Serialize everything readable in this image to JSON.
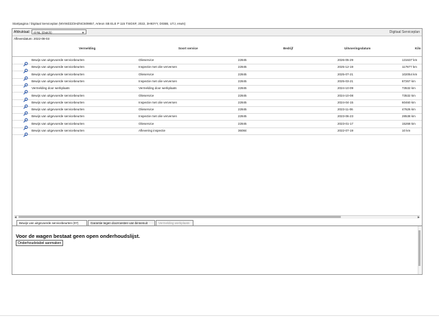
{
  "breadcrumb": "Startpagina / Digitaal Serviceplan (WVWZZZ3HZNC509857, Arteon SB ELE P 115 TSIDSF, 2022, 3H93YY, DGBB, U7J, erwin)",
  "toolbar": {
    "print_label": "Afdruktaal:",
    "language_value": "nl-NL (Dutch)",
    "app_title": "Digitaal Serviceplan"
  },
  "print_date": "Afleverdatum: 2022-08-03",
  "table": {
    "columns": [
      "Vermelding",
      "Soort service",
      "Bedrijf",
      "Uitvoeringsdatum",
      "Kilo"
    ],
    "rows": [
      {
        "entry": "Bewijs van uitgevoerde servicebeurten",
        "type": "Olieservice",
        "company": "22845",
        "date": "2026-05-29",
        "km": "131637 km"
      },
      {
        "entry": "Bewijs van uitgevoerde servicebeurten",
        "type": "Inspectie met olie verversen",
        "company": "22845",
        "date": "2025-12-19",
        "km": "117877 km"
      },
      {
        "entry": "Bewijs van uitgevoerde servicebeurten",
        "type": "Olieservice",
        "company": "22845",
        "date": "2025-07-21",
        "km": "102054 km"
      },
      {
        "entry": "Bewijs van uitgevoerde servicebeurten",
        "type": "Inspectie met olie verversen",
        "company": "22845",
        "date": "2025-03-21",
        "km": "87267 km"
      },
      {
        "entry": "Vermelding door werkplaats",
        "type": "Vermelding door werkplaats",
        "company": "22845",
        "date": "2024-10-09",
        "km": "73532 km"
      },
      {
        "entry": "Bewijs van uitgevoerde servicebeurten",
        "type": "Olieservice",
        "company": "22845",
        "date": "2024-10-08",
        "km": "73532 km"
      },
      {
        "entry": "Bewijs van uitgevoerde servicebeurten",
        "type": "Inspectie met olie verversen",
        "company": "22845",
        "date": "2024-04-15",
        "km": "60460 km"
      },
      {
        "entry": "Bewijs van uitgevoerde servicebeurten",
        "type": "Olieservice",
        "company": "22845",
        "date": "2023-11-06",
        "km": "47626 km"
      },
      {
        "entry": "Bewijs van uitgevoerde servicebeurten",
        "type": "Inspectie met olie verversen",
        "company": "22845",
        "date": "2023-06-23",
        "km": "28538 km"
      },
      {
        "entry": "Bewijs van uitgevoerde servicebeurten",
        "type": "Olieservice",
        "company": "22845",
        "date": "2023-01-17",
        "km": "15268 km"
      },
      {
        "entry": "Bewijs van uitgevoerde servicebeurten",
        "type": "Aflevering inspectie",
        "company": "36084",
        "date": "2022-07-19",
        "km": "10 km"
      }
    ]
  },
  "tabs": [
    {
      "label": "Bewijs van uitgevoerde servicebeurten (07)"
    },
    {
      "label": "Garantie tegen doorroesten van binnenuit"
    },
    {
      "label": "Vermelding werkplaats"
    }
  ],
  "panel": {
    "message": "Voor de wagen bestaat geen open onderhoudslijst.",
    "button_label": "Onderhoudstabel aanmaken"
  },
  "icons": {
    "row_icon": "magnifier-icon",
    "dropdown": "chevron-down-icon"
  },
  "colors": {
    "icon_blue": "#1f4fa6"
  }
}
